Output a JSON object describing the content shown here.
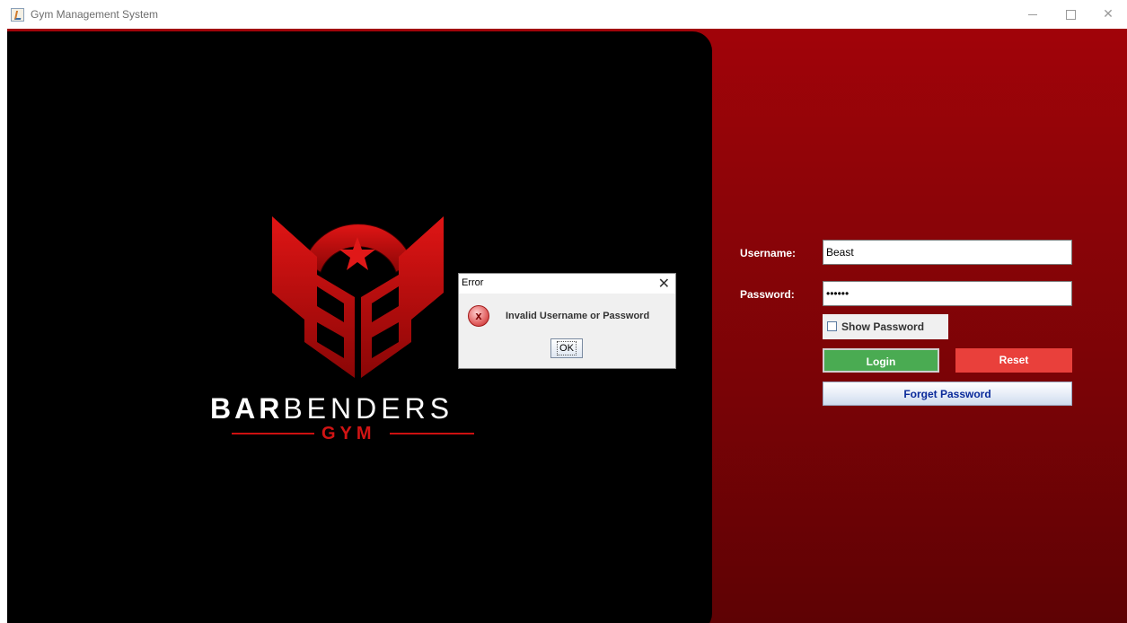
{
  "window": {
    "title": "Gym Management System",
    "icon": "java-icon",
    "controls": [
      "minimize-icon",
      "maximize-icon",
      "close-icon"
    ]
  },
  "logo": {
    "word_bold": "BAR",
    "word_light": "BENDERS",
    "sub": "GYM"
  },
  "form": {
    "username_label": "Username:",
    "username_value": "Beast",
    "password_label": "Password:",
    "password_value": "••••••",
    "show_password_label": "Show Password",
    "show_password_checked": false,
    "login_label": "Login",
    "reset_label": "Reset",
    "forget_label": "Forget Password"
  },
  "dialog": {
    "title": "Error",
    "message": "Invalid Username or Password",
    "ok_label": "OK",
    "icon": "error-icon"
  },
  "colors": {
    "accent_red": "#a10309",
    "login_green": "#4aab52",
    "reset_red": "#e9403b",
    "forget_text": "#0a2a9a"
  }
}
